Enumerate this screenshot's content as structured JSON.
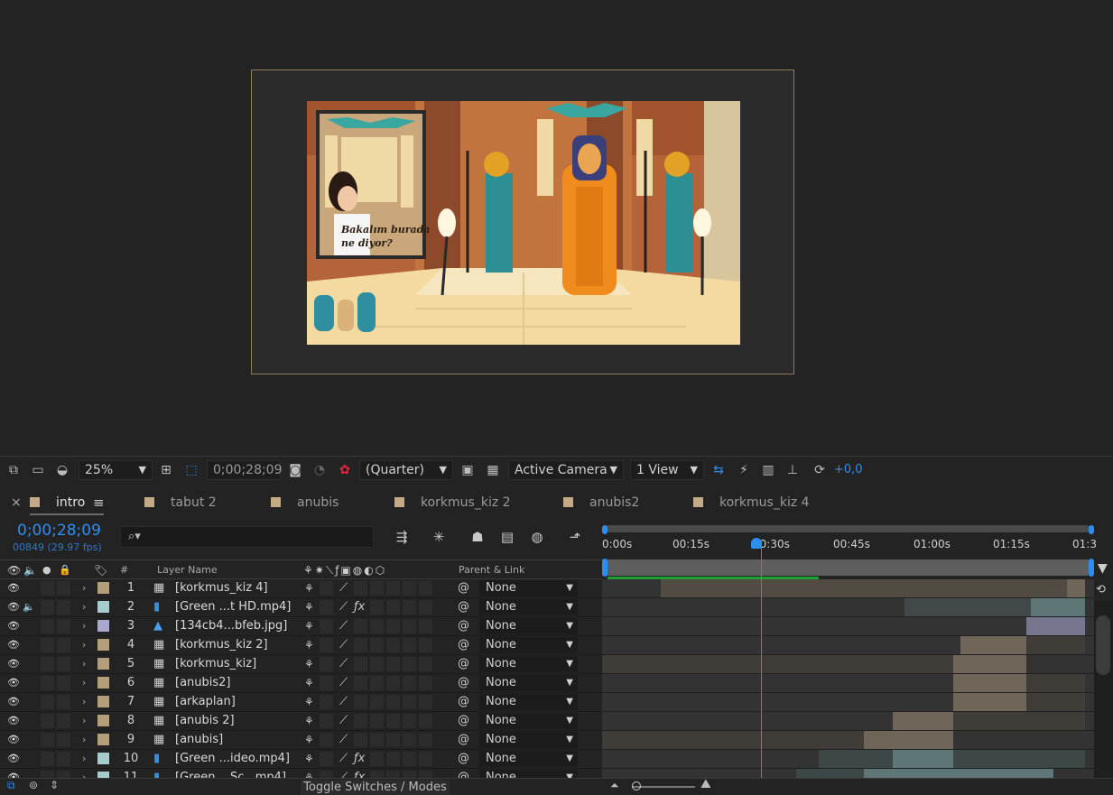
{
  "viewer": {
    "caption_line1": "Bakalım burada",
    "caption_line2": "ne diyor?"
  },
  "viewer_toolbar": {
    "zoom": "25%",
    "timecode": "0;00;28;09",
    "resolution": "(Quarter)",
    "camera": "Active Camera",
    "views": "1 View",
    "exposure": "+0,0"
  },
  "tabs": [
    {
      "label": "intro",
      "active": true
    },
    {
      "label": "tabut 2"
    },
    {
      "label": "anubis"
    },
    {
      "label": "korkmus_kiz 2"
    },
    {
      "label": "anubis2"
    },
    {
      "label": "korkmus_kiz 4"
    }
  ],
  "timeline": {
    "timecode": "0;00;28;09",
    "frames": "00849 (29.97 fps)",
    "search_placeholder": "⌕▾",
    "col_num": "#",
    "col_layer_name": "Layer Name",
    "col_parent": "Parent & Link",
    "ruler_labels": [
      "0:00s",
      "00:15s",
      "00:30s",
      "00:45s",
      "01:00s",
      "01:15s",
      "01:3"
    ],
    "toggle_label": "Toggle Switches / Modes"
  },
  "layers": [
    {
      "num": "1",
      "name": "[korkmus_kiz 4]",
      "color": "#b59e7c",
      "type": "comp",
      "audio": false,
      "fx": false,
      "parent": "None"
    },
    {
      "num": "2",
      "name": "[Green ...t HD.mp4]",
      "color": "#a6cccb",
      "type": "footage",
      "audio": true,
      "fx": true,
      "parent": "None"
    },
    {
      "num": "3",
      "name": "[134cb4...bfeb.jpg]",
      "color": "#a9a8cf",
      "type": "image",
      "audio": false,
      "fx": false,
      "parent": "None"
    },
    {
      "num": "4",
      "name": "[korkmus_kiz 2]",
      "color": "#b59e7c",
      "type": "comp",
      "audio": false,
      "fx": false,
      "parent": "None"
    },
    {
      "num": "5",
      "name": "[korkmus_kiz]",
      "color": "#b59e7c",
      "type": "comp",
      "audio": false,
      "fx": false,
      "parent": "None"
    },
    {
      "num": "6",
      "name": "[anubis2]",
      "color": "#b59e7c",
      "type": "comp",
      "audio": false,
      "fx": false,
      "parent": "None"
    },
    {
      "num": "7",
      "name": "[arkaplan]",
      "color": "#b59e7c",
      "type": "comp",
      "audio": false,
      "fx": false,
      "parent": "None"
    },
    {
      "num": "8",
      "name": "[anubis 2]",
      "color": "#b59e7c",
      "type": "comp",
      "audio": false,
      "fx": false,
      "parent": "None"
    },
    {
      "num": "9",
      "name": "[anubis]",
      "color": "#b59e7c",
      "type": "comp",
      "audio": false,
      "fx": false,
      "parent": "None"
    },
    {
      "num": "10",
      "name": "[Green ...ideo.mp4]",
      "color": "#a6cccb",
      "type": "footage",
      "audio": false,
      "fx": true,
      "parent": "None"
    },
    {
      "num": "11",
      "name": "[Green ...Sc...mp4]",
      "color": "#a6cccb",
      "type": "footage",
      "audio": false,
      "fx": true,
      "parent": "None"
    }
  ],
  "colors": {
    "accent": "#2e8ef0",
    "comp_label": "#b59e7c",
    "footage_label": "#a6cccb",
    "image_label": "#a9a8cf"
  }
}
